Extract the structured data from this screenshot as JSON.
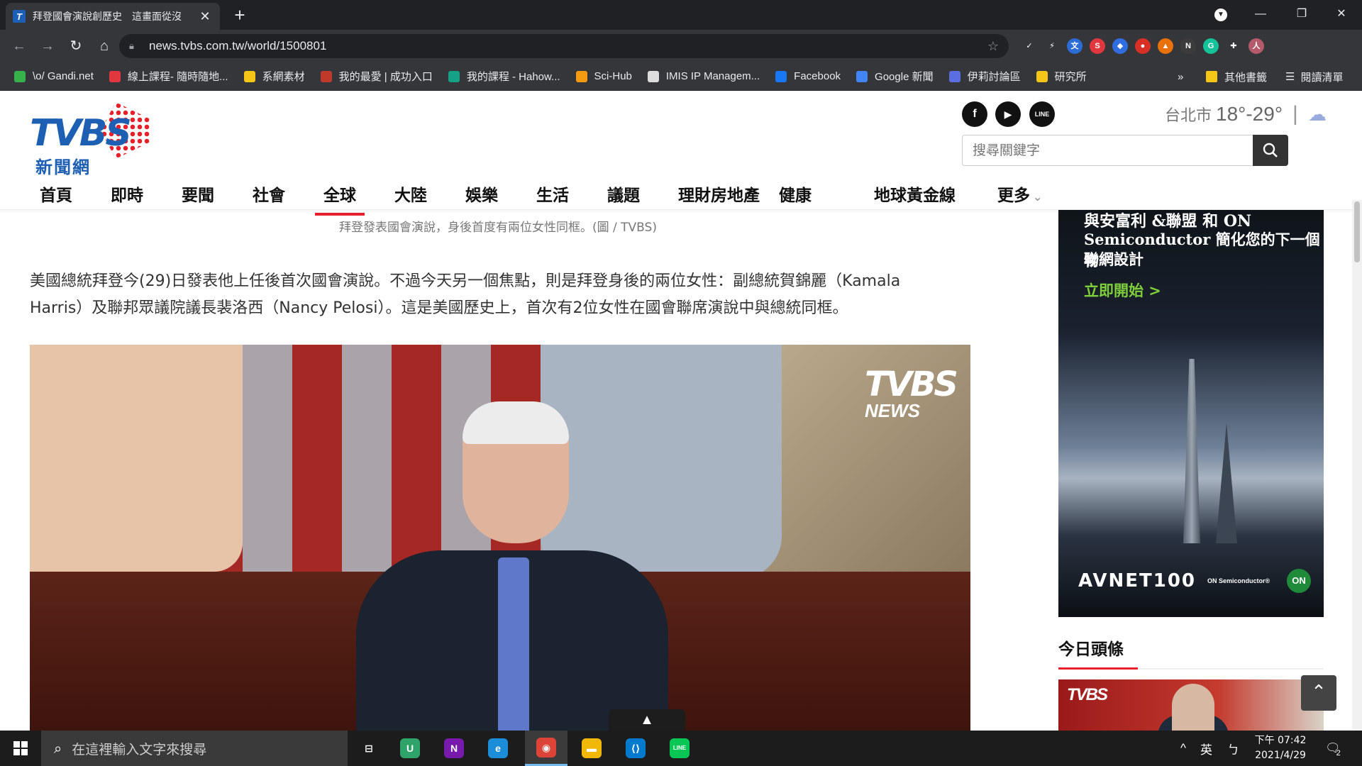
{
  "browser": {
    "tab_title": "拜登國會演說創歷史　這畫面從沒",
    "url": "news.tvbs.com.tw/world/1500801",
    "window_controls": [
      "—",
      "❐",
      "✕"
    ],
    "extensions": [
      {
        "name": "check-ext",
        "glyph": "✓",
        "color": "#35363a"
      },
      {
        "name": "bolt-ext",
        "glyph": "⚡",
        "color": "#35363a"
      },
      {
        "name": "translate-ext",
        "glyph": "文",
        "color": "#2b6cd6"
      },
      {
        "name": "s-ext",
        "glyph": "S",
        "color": "#e0383e"
      },
      {
        "name": "shield-ext",
        "glyph": "◆",
        "color": "#2f6de1"
      },
      {
        "name": "record-ext",
        "glyph": "●",
        "color": "#d93025"
      },
      {
        "name": "fire-ext",
        "glyph": "▲",
        "color": "#e8710a"
      },
      {
        "name": "notion-ext",
        "glyph": "N",
        "color": "#3c3c3c"
      },
      {
        "name": "grammarly-ext",
        "glyph": "G",
        "color": "#15c39a"
      },
      {
        "name": "puzzle-ext",
        "glyph": "✚",
        "color": "#35363a"
      },
      {
        "name": "profile-avatar",
        "glyph": "人",
        "color": "#b55a6a"
      }
    ],
    "bookmarks": [
      {
        "label": "\\o/ Gandi.net",
        "color": "#35b24a"
      },
      {
        "label": "線上課程- 隨時隨地...",
        "color": "#e0383e"
      },
      {
        "label": "系網素材",
        "color": "#f5c518"
      },
      {
        "label": "我的最愛 | 成功入口",
        "color": "#c0392b"
      },
      {
        "label": "我的課程 - Hahow...",
        "color": "#16a085"
      },
      {
        "label": "Sci-Hub",
        "color": "#f39c12"
      },
      {
        "label": "IMIS IP Managem...",
        "color": "#dddddd"
      },
      {
        "label": "Facebook",
        "color": "#1877f2"
      },
      {
        "label": "Google 新聞",
        "color": "#4285f4"
      },
      {
        "label": "伊莉討論區",
        "color": "#5b6ee1"
      },
      {
        "label": "研究所",
        "color": "#f5c518"
      }
    ],
    "overflow": "»",
    "other_bookmarks": "其他書籤",
    "reading_list": "閱讀清單"
  },
  "site": {
    "logo_text": "TVBS",
    "logo_subtext": "新聞網",
    "social": [
      {
        "name": "facebook",
        "glyph": "f"
      },
      {
        "name": "youtube",
        "glyph": "▶"
      },
      {
        "name": "line",
        "glyph": "LINE"
      }
    ],
    "weather": {
      "city": "台北市",
      "temp": "18°-29°",
      "sep": "|",
      "icon": "☁"
    },
    "search_placeholder": "搜尋關鍵字",
    "nav": [
      "首頁",
      "即時",
      "要聞",
      "社會",
      "全球",
      "大陸",
      "娛樂",
      "生活",
      "議題",
      "理財房地產",
      "健康",
      "地球黃金線",
      "更多"
    ],
    "nav_more_chevron": "⌄"
  },
  "article": {
    "caption": "拜登發表國會演說，身後首度有兩位女性同框。(圖 / TVBS)",
    "paragraph_line1": "美國總統拜登今(29)日發表他上任後首次國會演說。不過今天另一個焦點，則是拜登身後的兩位女性：副總統賀錦麗（Kamala",
    "paragraph_line2": "Harris）及聯邦眾議院議長裴洛西（Nancy Pelosi）。這是美國歷史上，首次有2位女性在國會聯席演說中與總統同框。",
    "video_logo": "TVBS",
    "video_logo_sub": "NEWS"
  },
  "ad": {
    "line1": "與安富利 &聯盟 和 ON",
    "line2": "Semiconductor 簡化您的下一個物",
    "line3": "聯網設計",
    "cta": "立即開始 >",
    "brand": "AVNET100",
    "partner": "ON Semiconductor®",
    "partner_logo": "ON"
  },
  "sidebar": {
    "today_title": "今日頭條",
    "thumb_logo": "TVBS",
    "scroll_top": "⌃"
  },
  "taskbar": {
    "search_placeholder": "在這裡輸入文字來搜尋",
    "apps": [
      {
        "name": "task-view",
        "glyph": "⊟",
        "color": "#1c1c1c"
      },
      {
        "name": "app-u",
        "glyph": "U",
        "color": "#2ea36a"
      },
      {
        "name": "onenote",
        "glyph": "N",
        "color": "#7719aa"
      },
      {
        "name": "edge-app",
        "glyph": "e",
        "color": "#1c8dd8"
      },
      {
        "name": "chrome",
        "glyph": "◉",
        "color": "#db4437"
      },
      {
        "name": "file-explorer",
        "glyph": "▬",
        "color": "#f2b807"
      },
      {
        "name": "vscode",
        "glyph": "⟨⟩",
        "color": "#007acc"
      },
      {
        "name": "line-app",
        "glyph": "LINE",
        "color": "#06c755"
      }
    ],
    "tray_chevron": "^",
    "ime": "英",
    "ime_mode": "ㄅ",
    "time": "下午 07:42",
    "date": "2021/4/29",
    "notifications": "2"
  }
}
